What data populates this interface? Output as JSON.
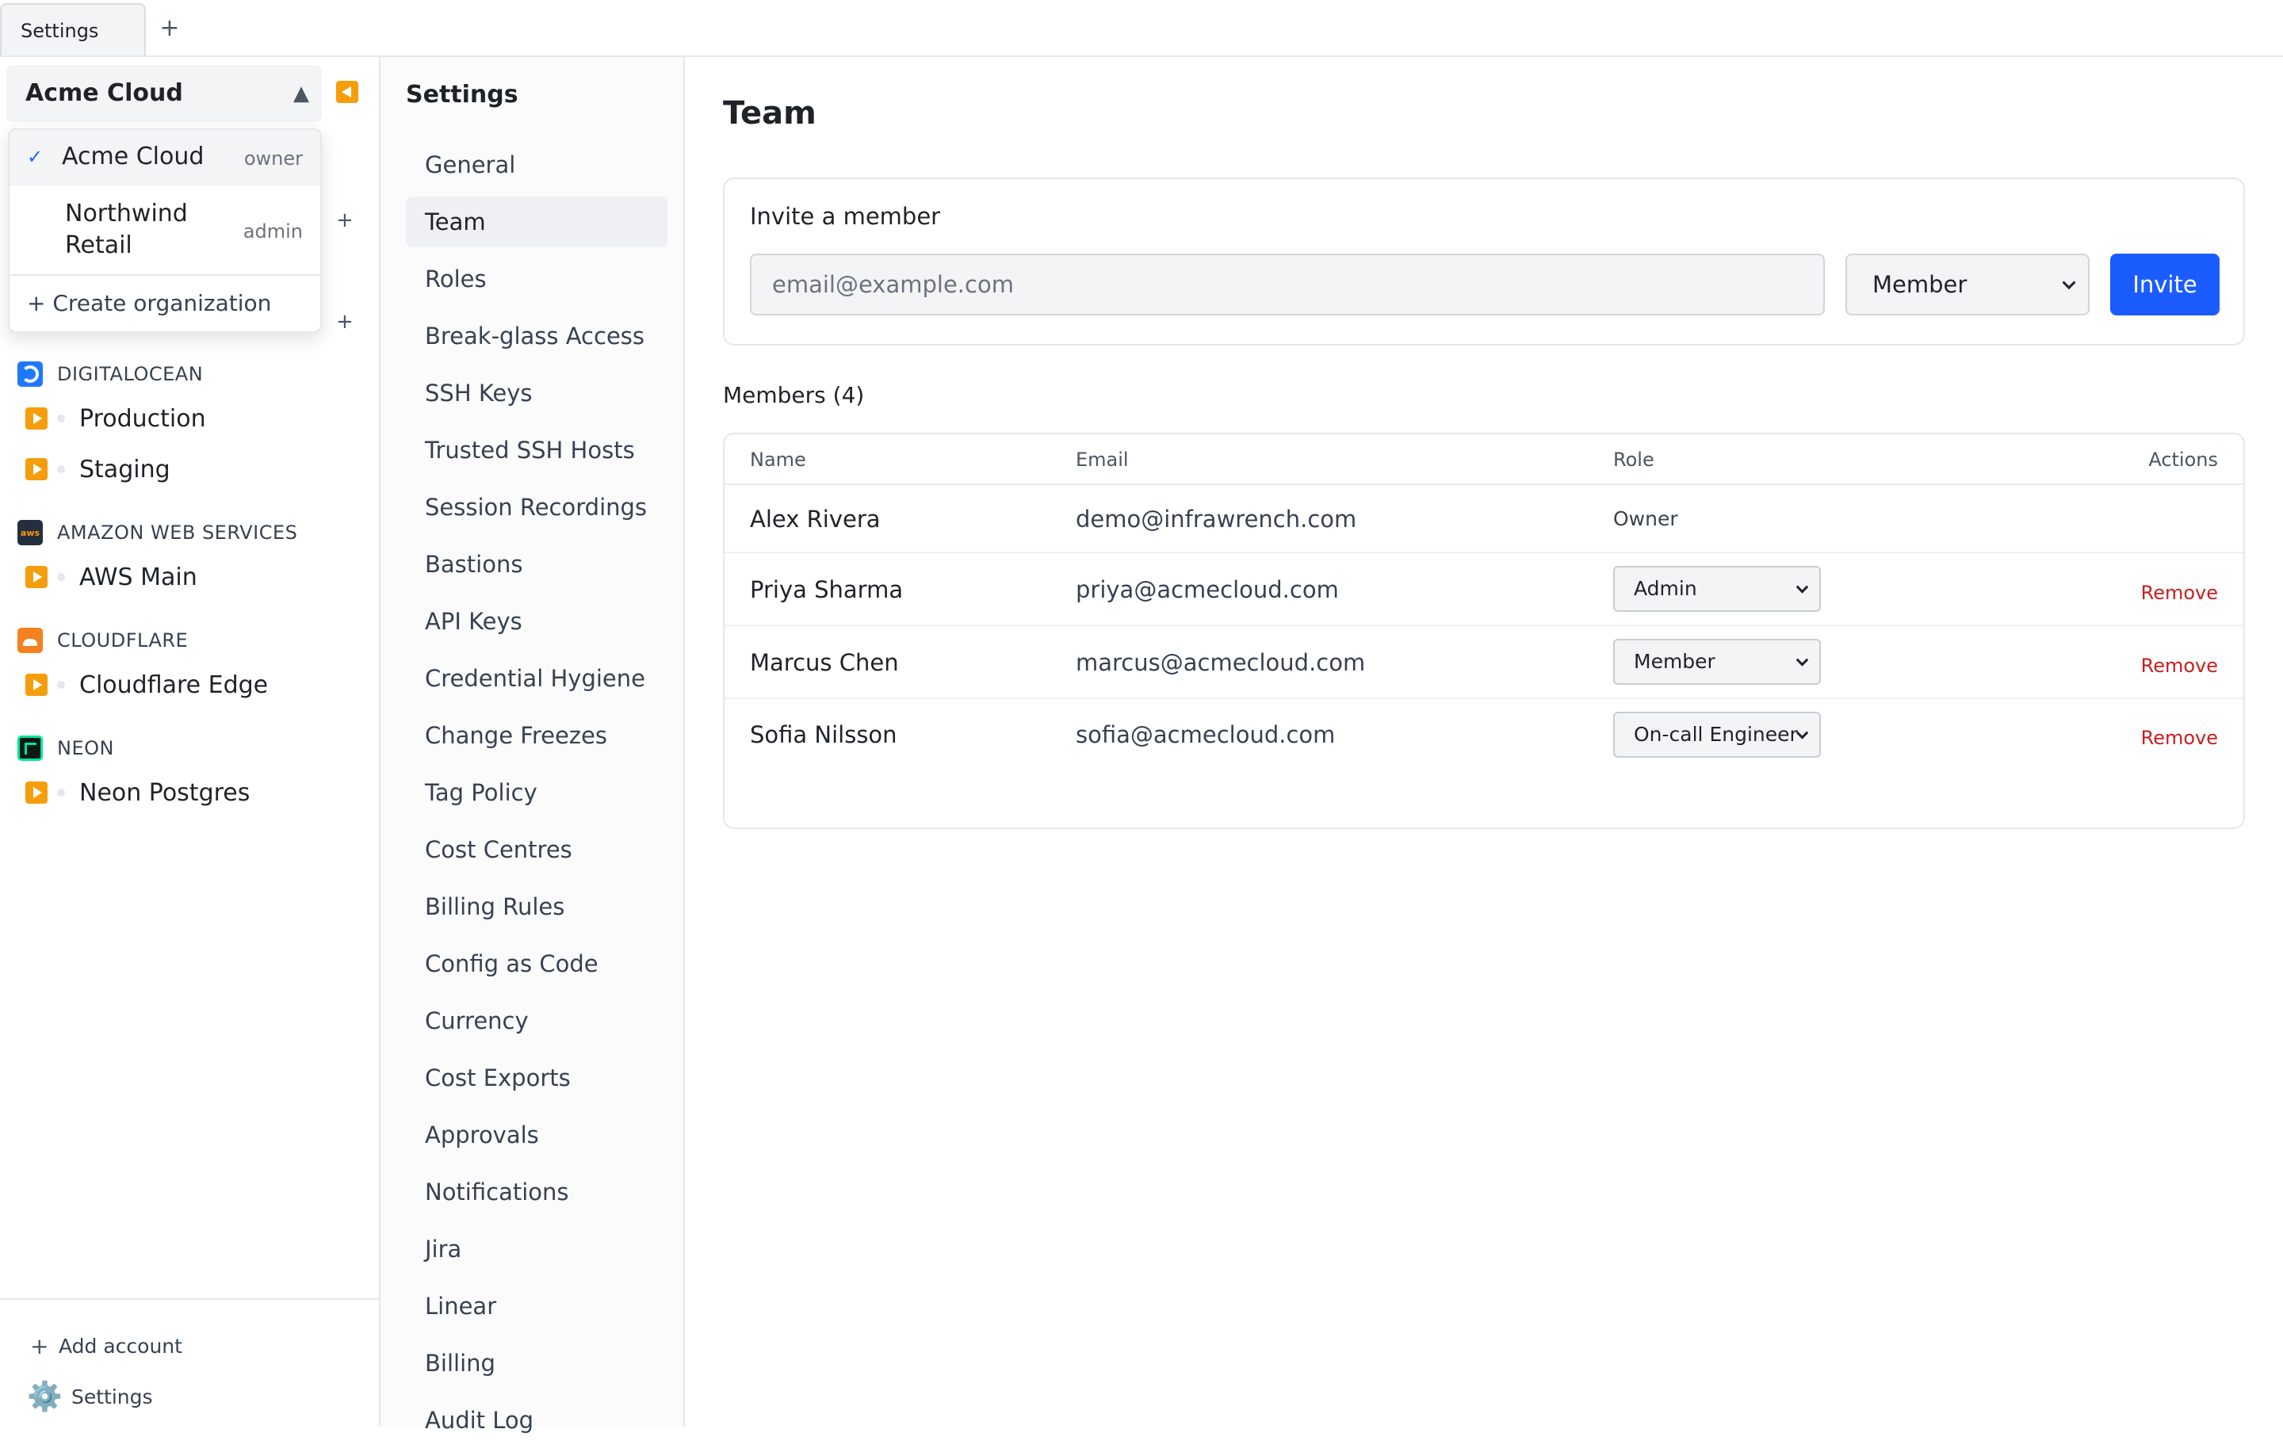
{
  "tabs": [
    {
      "label": "Settings"
    }
  ],
  "tab_add_label": "+",
  "sidebar": {
    "org_switcher": {
      "current": "Acme Cloud"
    },
    "org_menu": {
      "items": [
        {
          "name": "Acme Cloud",
          "role": "owner",
          "selected": true,
          "check": "✓"
        },
        {
          "name_line1": "Northwind",
          "name_line2": "Retail",
          "role": "admin",
          "selected": false
        }
      ],
      "create_label": "+ Create organization"
    },
    "providers": [
      {
        "label": "DIGITALOCEAN",
        "icon": "digitalocean-icon",
        "accounts": [
          {
            "label": "Production"
          },
          {
            "label": "Staging"
          }
        ]
      },
      {
        "label": "AMAZON WEB SERVICES",
        "icon": "aws-icon",
        "icon_text": "aws",
        "accounts": [
          {
            "label": "AWS Main"
          }
        ]
      },
      {
        "label": "CLOUDFLARE",
        "icon": "cloudflare-icon",
        "accounts": [
          {
            "label": "Cloudflare Edge"
          }
        ]
      },
      {
        "label": "NEON",
        "icon": "neon-icon",
        "accounts": [
          {
            "label": "Neon Postgres"
          }
        ]
      }
    ],
    "footer": {
      "add_account": "Add account",
      "add_icon": "+",
      "settings": "Settings",
      "settings_icon": "⚙️"
    }
  },
  "settings_nav": {
    "title": "Settings",
    "items": [
      "General",
      "Team",
      "Roles",
      "Break-glass Access",
      "SSH Keys",
      "Trusted SSH Hosts",
      "Session Recordings",
      "Bastions",
      "API Keys",
      "Credential Hygiene",
      "Change Freezes",
      "Tag Policy",
      "Cost Centres",
      "Billing Rules",
      "Config as Code",
      "Currency",
      "Cost Exports",
      "Approvals",
      "Notifications",
      "Jira",
      "Linear",
      "Billing",
      "Audit Log"
    ],
    "active": "Team"
  },
  "main": {
    "title": "Team",
    "invite": {
      "title": "Invite a member",
      "email_placeholder": "email@example.com",
      "role_value": "Member",
      "button": "Invite"
    },
    "members_title": "Members (4)",
    "table": {
      "headers": {
        "name": "Name",
        "email": "Email",
        "role": "Role",
        "actions": "Actions"
      },
      "rows": [
        {
          "name": "Alex Rivera",
          "email": "demo@infrawrench.com",
          "role": "Owner",
          "editable": false,
          "action": ""
        },
        {
          "name": "Priya Sharma",
          "email": "priya@acmecloud.com",
          "role": "Admin",
          "editable": true,
          "action": "Remove"
        },
        {
          "name": "Marcus Chen",
          "email": "marcus@acmecloud.com",
          "role": "Member",
          "editable": true,
          "action": "Remove"
        },
        {
          "name": "Sofia Nilsson",
          "email": "sofia@acmecloud.com",
          "role": "On-call Engineer",
          "editable": true,
          "action": "Remove"
        }
      ]
    }
  },
  "colors": {
    "accent": "#1a5cff",
    "danger": "#c81e1e",
    "account_icon": "#f59e0b"
  }
}
